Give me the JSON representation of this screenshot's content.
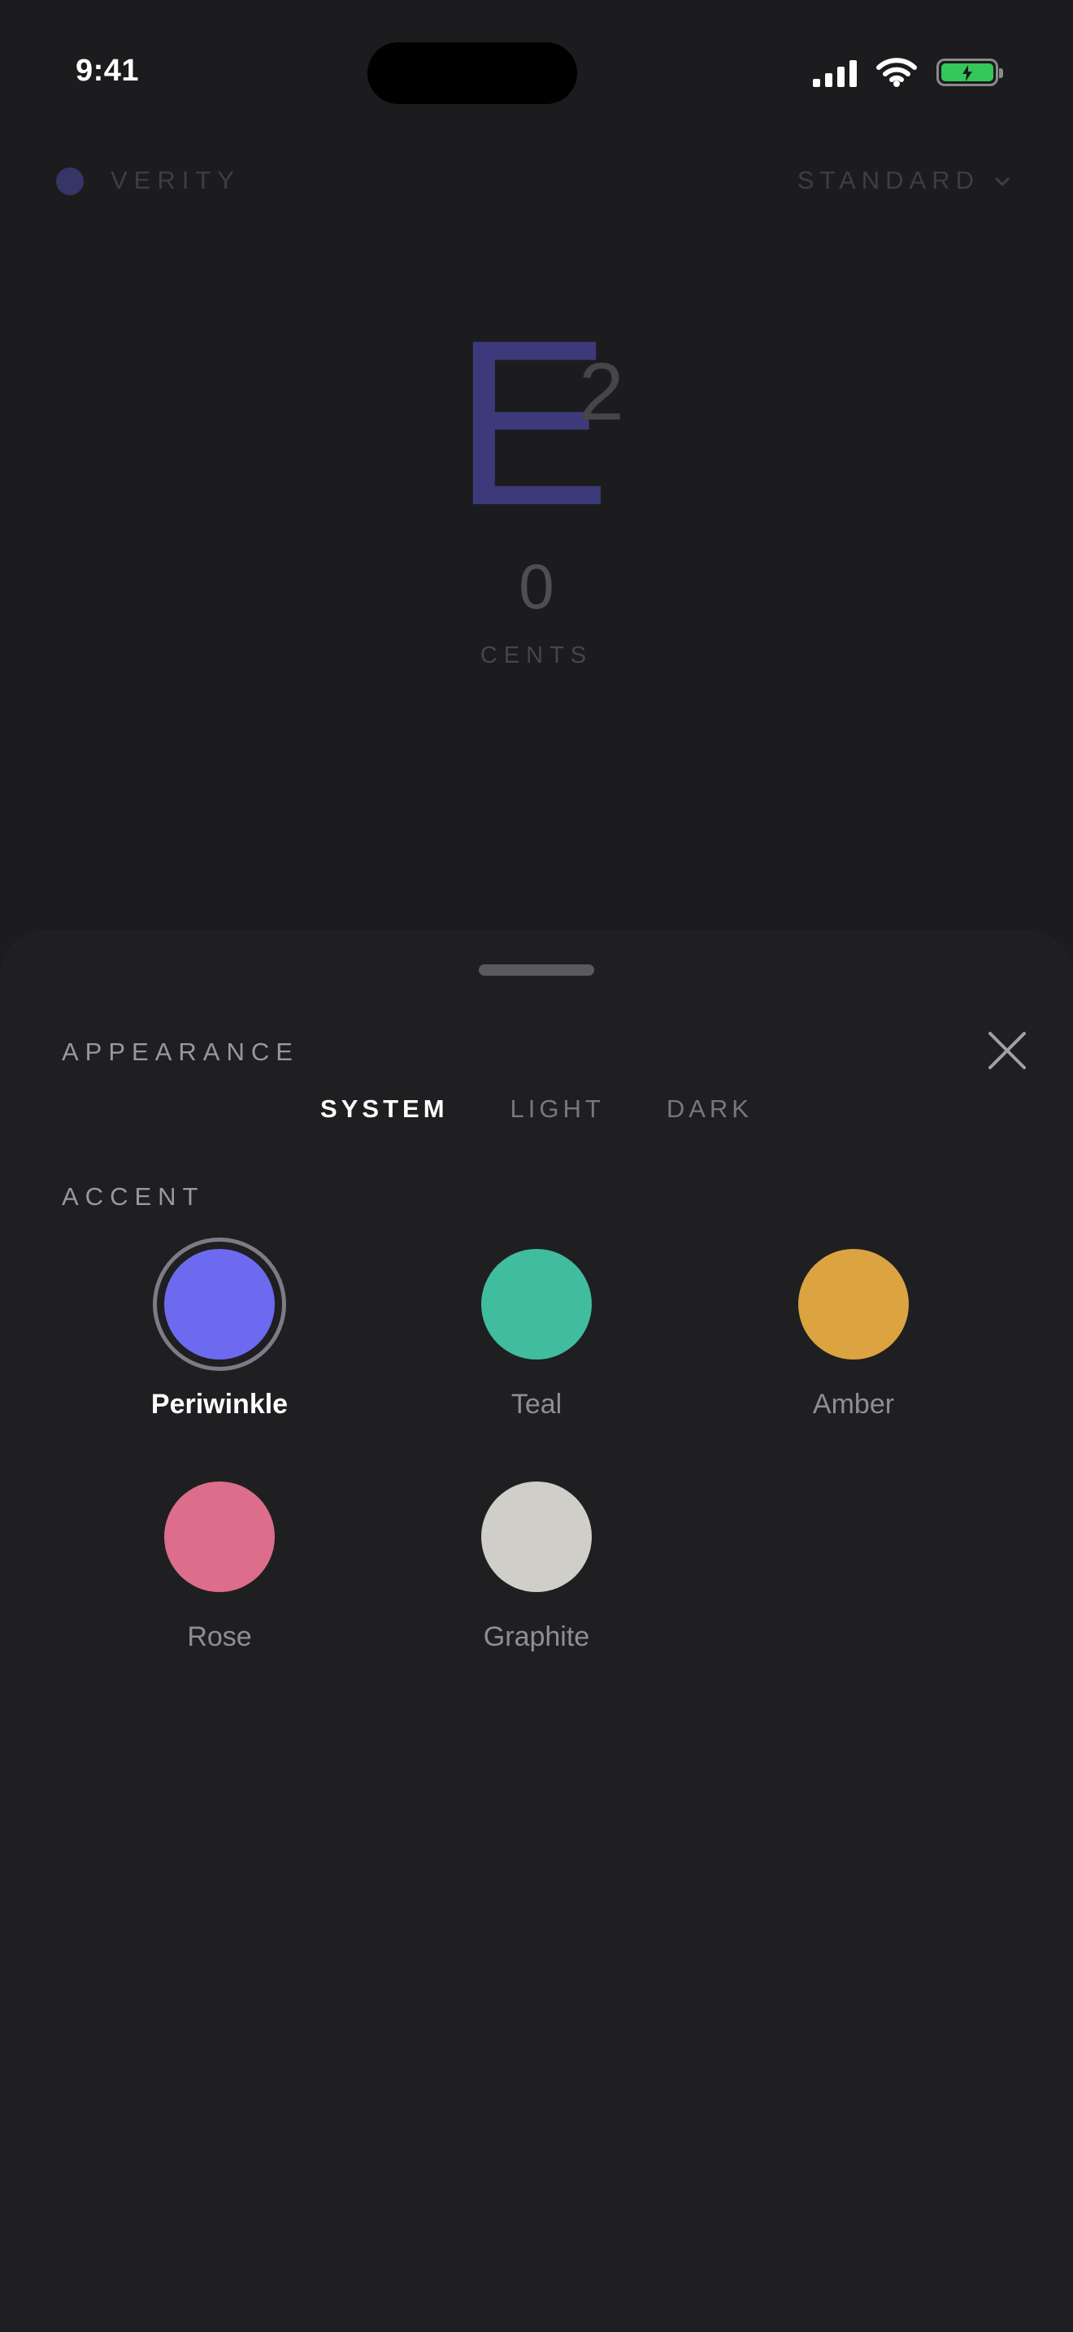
{
  "status": {
    "time": "9:41"
  },
  "app": {
    "brand": "VERITY",
    "tuning": "STANDARD"
  },
  "tuner": {
    "note": "E",
    "octave": "2",
    "cents_value": "0",
    "cents_label": "CENTS"
  },
  "sheet": {
    "appearance_title": "APPEARANCE",
    "appearance_options": [
      {
        "label": "SYSTEM",
        "selected": true
      },
      {
        "label": "LIGHT",
        "selected": false
      },
      {
        "label": "DARK",
        "selected": false
      }
    ],
    "accent_title": "ACCENT",
    "accents": [
      {
        "name": "Periwinkle",
        "color": "#6e6af0",
        "selected": true
      },
      {
        "name": "Teal",
        "color": "#40bd9f",
        "selected": false
      },
      {
        "name": "Amber",
        "color": "#dba441",
        "selected": false
      },
      {
        "name": "Rose",
        "color": "#dc6e8b",
        "selected": false
      },
      {
        "name": "Graphite",
        "color": "#d0cec8",
        "selected": false
      }
    ]
  },
  "colors": {
    "brand_dot": "#4f4ba3",
    "note": "#5954c9",
    "battery": "#34c759"
  },
  "icons": [
    "signal-icon",
    "wifi-icon",
    "battery-icon",
    "chevron-down-icon",
    "close-icon"
  ]
}
